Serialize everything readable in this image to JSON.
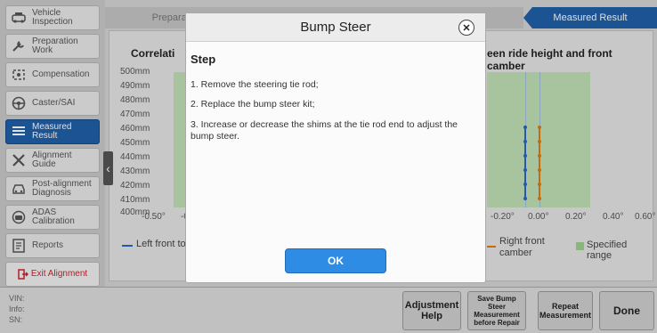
{
  "sidebar": {
    "items": [
      {
        "label": "Vehicle\nInspection",
        "icon": "car-inspect-icon"
      },
      {
        "label": "Preparation\nWork",
        "icon": "wrench-prep-icon"
      },
      {
        "label": "Compensation",
        "icon": "compensation-icon"
      },
      {
        "label": "Caster/SAI",
        "icon": "steering-wheel-icon"
      },
      {
        "label": "Measured\nResult",
        "icon": "list-icon",
        "active": true
      },
      {
        "label": "Alignment\nGuide",
        "icon": "tools-icon"
      },
      {
        "label": "Post-alignment\nDiagnosis",
        "icon": "car-diagnosis-icon"
      },
      {
        "label": "ADAS\nCalibration",
        "icon": "adas-icon"
      },
      {
        "label": "Reports",
        "icon": "report-icon"
      }
    ],
    "exit_label": "Exit Alignment"
  },
  "tabs": [
    {
      "label": "Preparati"
    },
    {
      "label": ""
    },
    {
      "label": "Measured Result",
      "active": true
    }
  ],
  "chart": {
    "title_left": "Correlati",
    "title_right": "een ride height and front camber",
    "y_ticks": [
      "500mm",
      "490mm",
      "480mm",
      "470mm",
      "460mm",
      "450mm",
      "440mm",
      "430mm",
      "420mm",
      "410mm",
      "400mm"
    ],
    "x_ticks_left": [
      "-0.50°",
      "-0."
    ],
    "x_ticks_right": [
      "-0.20°",
      "0.00°",
      "0.20°",
      "0.40°",
      "0.60°"
    ],
    "legend": {
      "left_front_toe": "Left front toe",
      "right_front_camber": "Right front\ncamber",
      "specified_range": "Specified range"
    },
    "colors": {
      "blue_series": "#2a66c4",
      "orange_series": "#e07a12",
      "range": "#bfe0b4"
    }
  },
  "bottom": {
    "vin_label": "VIN:",
    "info_label": "Info:",
    "sn_label": "SN:",
    "buttons": {
      "adjustment_help": "Adjustment\nHelp",
      "save_bump": "Save Bump\nSteer\nMeasurement\nbefore Repair",
      "repeat": "Repeat\nMeasurement",
      "done": "Done"
    }
  },
  "dialog": {
    "title": "Bump Steer",
    "close_glyph": "✕",
    "step_heading": "Step",
    "lines": [
      "1. Remove the steering tie rod;",
      "2. Replace the bump steer kit;",
      "3. Increase or decrease the shims at the tie rod end to adjust the bump steer."
    ],
    "ok_label": "OK"
  }
}
